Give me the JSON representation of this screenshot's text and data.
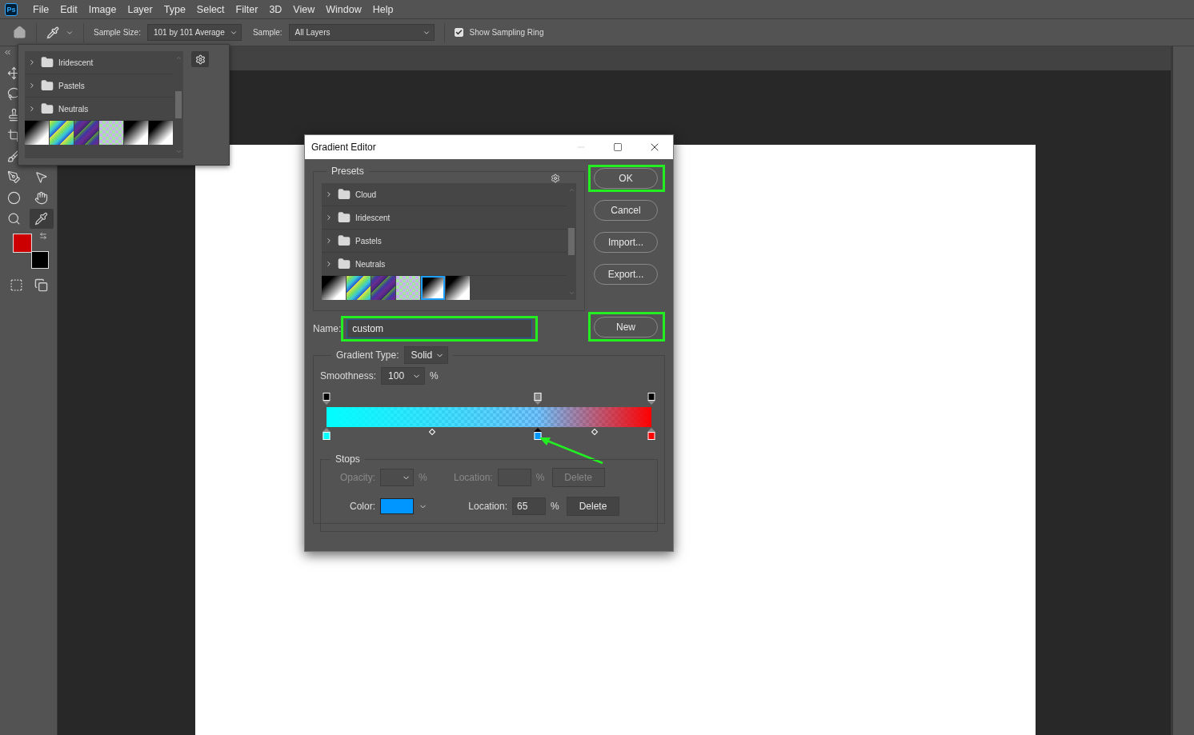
{
  "app_badge": "Ps",
  "menu": [
    {
      "label": "File"
    },
    {
      "label": "Edit"
    },
    {
      "label": "Image"
    },
    {
      "label": "Layer"
    },
    {
      "label": "Type"
    },
    {
      "label": "Select"
    },
    {
      "label": "Filter"
    },
    {
      "label": "3D"
    },
    {
      "label": "View"
    },
    {
      "label": "Window"
    },
    {
      "label": "Help"
    }
  ],
  "options_bar": {
    "sample_size_label": "Sample Size:",
    "sample_size": "101 by 101 Average",
    "sample_label": "Sample:",
    "sample": "All Layers",
    "sampling_ring": {
      "label": "Show Sampling Ring",
      "checked": true
    }
  },
  "toolbar": {
    "rows": [
      {
        "tools": [
          {
            "kind": "move",
            "selected": false
          }
        ]
      },
      {
        "tools": [
          {
            "kind": "lasso",
            "selected": false
          }
        ]
      },
      {
        "tools": [
          {
            "kind": "stamp",
            "selected": false
          }
        ]
      },
      {
        "tools": [
          {
            "kind": "crop",
            "selected": false
          }
        ]
      },
      {
        "tools": [
          {
            "kind": "brush",
            "selected": false
          }
        ]
      },
      {
        "tools": [
          {
            "kind": "pen",
            "selected": false
          },
          {
            "kind": "pointer",
            "selected": false
          }
        ]
      },
      {
        "tools": [
          {
            "kind": "ellipse",
            "selected": false
          },
          {
            "kind": "hand",
            "selected": false
          }
        ]
      },
      {
        "tools": [
          {
            "kind": "zoom",
            "selected": false
          },
          {
            "kind": "eyedropper",
            "selected": true
          }
        ]
      }
    ],
    "foreground": {
      "color": "#cc0000"
    },
    "background": {
      "color": "#000000"
    }
  },
  "preset_popup": {
    "groups": [
      {
        "name": "Iridescent",
        "expanded": false
      },
      {
        "name": "Pastels",
        "expanded": false
      },
      {
        "name": "Neutrals",
        "expanded": false
      }
    ],
    "swatches": [
      {
        "kind": "mono",
        "selected": false
      },
      {
        "kind": "spectrum",
        "selected": false
      },
      {
        "kind": "violet",
        "selected": false
      },
      {
        "kind": "pastel",
        "selected": false
      },
      {
        "kind": "mono",
        "selected": false
      },
      {
        "kind": "mono",
        "selected": false
      }
    ]
  },
  "dialog": {
    "title": "Gradient Editor",
    "presets": {
      "legend": "Presets",
      "groups": [
        {
          "name": "Cloud",
          "expanded": false
        },
        {
          "name": "Iridescent",
          "expanded": false
        },
        {
          "name": "Pastels",
          "expanded": false
        },
        {
          "name": "Neutrals",
          "expanded": false
        }
      ],
      "swatches": [
        {
          "kind": "mono",
          "selected": false
        },
        {
          "kind": "spectrum",
          "selected": false
        },
        {
          "kind": "violet",
          "selected": false
        },
        {
          "kind": "pastel",
          "selected": false
        },
        {
          "kind": "mono",
          "selected": true
        },
        {
          "kind": "mono",
          "selected": false
        }
      ]
    },
    "buttons": [
      {
        "label": "OK",
        "highlighted": true
      },
      {
        "label": "Cancel",
        "highlighted": false
      },
      {
        "label": "Import...",
        "highlighted": false
      },
      {
        "label": "Export...",
        "highlighted": false
      }
    ],
    "name_label": "Name:",
    "name_value": "custom",
    "name_highlighted": true,
    "new_button": {
      "label": "New",
      "highlighted": true
    },
    "gradient_type_label": "Gradient Type:",
    "gradient_type": "Solid",
    "smoothness_label": "Smoothness:",
    "smoothness": "100",
    "smoothness_unit": "%",
    "opacity_stops": [
      {
        "level": 0,
        "color": "#000000",
        "selected": false
      },
      {
        "level": 0.65,
        "color": "#808080",
        "selected": false
      },
      {
        "level": 1,
        "color": "#000000",
        "selected": false
      }
    ],
    "color_stops": [
      {
        "level": 0,
        "color": "#00ffff",
        "selected": false
      },
      {
        "level": 0.65,
        "color": "#0096ff",
        "selected": true
      },
      {
        "level": 1,
        "color": "#ff0000",
        "selected": false
      }
    ],
    "arrow_to_selected": true,
    "stops": {
      "legend": "Stops",
      "opacity_row": {
        "disabled": true,
        "label": "Opacity:",
        "unit": "%",
        "location_label": "Location:",
        "location_unit": "%",
        "delete": "Delete"
      },
      "color_row": {
        "disabled": false,
        "label": "Color:",
        "color": "#0096ff",
        "location_label": "Location:",
        "location": "65",
        "location_unit": "%",
        "delete": "Delete"
      }
    }
  }
}
